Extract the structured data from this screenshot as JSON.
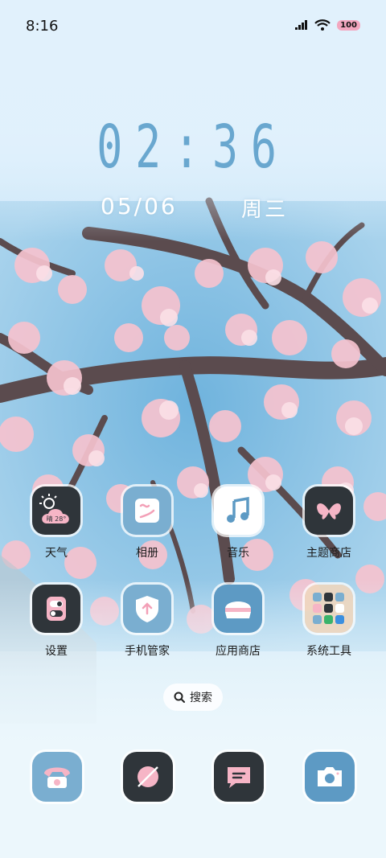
{
  "status_bar": {
    "time": "8:16",
    "battery": "100",
    "icons": [
      "signal-icon",
      "wifi-icon",
      "battery-icon"
    ]
  },
  "clock": {
    "time": "02:36",
    "date": "05/06",
    "weekday": "周三"
  },
  "weather_widget_icon_text": "晴 28°",
  "apps": [
    {
      "label": "天气",
      "icon": "weather-icon"
    },
    {
      "label": "相册",
      "icon": "gallery-icon"
    },
    {
      "label": "音乐",
      "icon": "music-icon"
    },
    {
      "label": "主题商店",
      "icon": "theme-store-icon"
    },
    {
      "label": "设置",
      "icon": "settings-icon"
    },
    {
      "label": "手机管家",
      "icon": "phone-manager-icon"
    },
    {
      "label": "应用商店",
      "icon": "app-store-icon"
    },
    {
      "label": "系统工具",
      "icon": "system-tools-folder-icon"
    }
  ],
  "search": {
    "label": "搜索"
  },
  "dock": [
    {
      "icon": "phone-icon"
    },
    {
      "icon": "browser-icon"
    },
    {
      "icon": "messages-icon"
    },
    {
      "icon": "camera-icon"
    }
  ],
  "colors": {
    "accent_blue": "#69a7cf",
    "icon_dark": "#2f353a",
    "icon_blue": "#7aaed0",
    "pink": "#f6b5c6"
  }
}
